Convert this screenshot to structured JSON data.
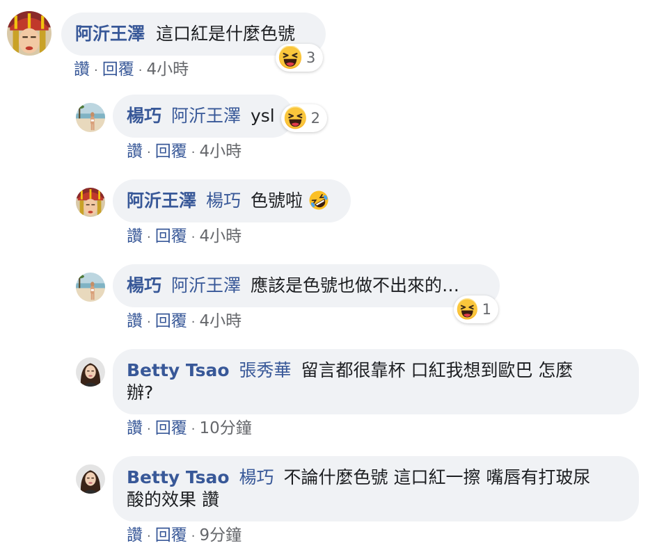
{
  "comments": [
    {
      "author": "阿沂王澤",
      "mention": "",
      "text": "這口紅是什麼色號",
      "reaction_count": "3",
      "actions": {
        "like": "讚",
        "reply": "回覆",
        "sep": "·",
        "time": "4小時"
      }
    },
    {
      "author": "楊巧",
      "mention": "阿沂王澤",
      "text": "ysl",
      "reaction_count": "2",
      "actions": {
        "like": "讚",
        "reply": "回覆",
        "sep": "·",
        "time": "4小時"
      }
    },
    {
      "author": "阿沂王澤",
      "mention": "楊巧",
      "text": "色號啦",
      "reaction_count": "",
      "actions": {
        "like": "讚",
        "reply": "回覆",
        "sep": "·",
        "time": "4小時"
      }
    },
    {
      "author": "楊巧",
      "mention": "阿沂王澤",
      "text": "應該是色號也做不出來的…",
      "reaction_count": "1",
      "actions": {
        "like": "讚",
        "reply": "回覆",
        "sep": "·",
        "time": "4小時"
      }
    },
    {
      "author": "Betty Tsao",
      "mention": "張秀華",
      "text": "留言都很靠杯 口紅我想到歐巴 怎麼",
      "text2": "辦?",
      "reaction_count": "",
      "actions": {
        "like": "讚",
        "reply": "回覆",
        "sep": "·",
        "time": "10分鐘"
      }
    },
    {
      "author": "Betty Tsao",
      "mention": "楊巧",
      "text": "不論什麼色號 這口紅一擦 嘴唇有打玻尿",
      "text2": "酸的效果 讚",
      "reaction_count": "",
      "actions": {
        "like": "讚",
        "reply": "回覆",
        "sep": "·",
        "time": "9分鐘"
      }
    }
  ],
  "icons": {
    "reaction": "laughing-face-emoji",
    "inline_emoji": "rolling-on-floor-laughing-emoji"
  },
  "colors": {
    "name": "#385898",
    "bubble": "#f0f2f5",
    "meta": "#65676b"
  }
}
